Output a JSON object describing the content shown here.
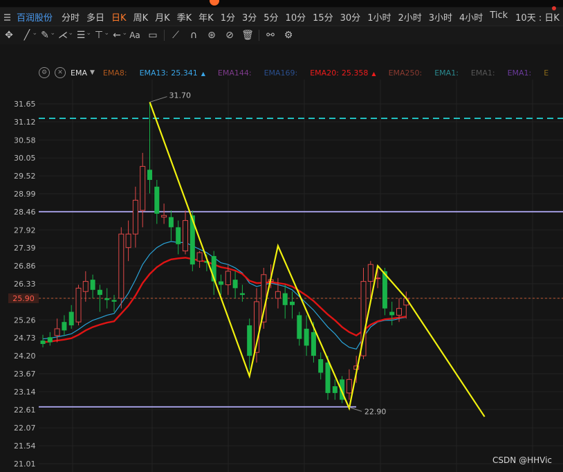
{
  "window": {
    "title": "百润股份"
  },
  "toolbar": {
    "stock_name": "百润股份",
    "timeframes": [
      "分时",
      "多日",
      "日K",
      "周K",
      "月K",
      "季K",
      "年K",
      "1分",
      "3分",
      "5分",
      "10分",
      "15分",
      "30分",
      "1小时",
      "2小时",
      "3小时",
      "4小时",
      "Tick"
    ],
    "active_timeframe": "日K",
    "period_label": "10天 : 日K"
  },
  "drawing_tools": [
    "move-icon",
    "line-icon",
    "pen-icon",
    "pattern-icon",
    "fib-icon",
    "measure-icon",
    "arrow-icon",
    "text-icon",
    "comment-icon",
    "ruler-icon",
    "magnet-icon",
    "eye-icon",
    "hide-icon",
    "trash-icon",
    "link-icon",
    "settings-icon"
  ],
  "indicator": {
    "name": "EMA",
    "items": [
      {
        "label": "EMA8:",
        "value": "",
        "color": "#b0581e"
      },
      {
        "label": "EMA13:",
        "value": "25.341",
        "color": "#3aa6e8",
        "arrow": "▲"
      },
      {
        "label": "EMA144:",
        "value": "",
        "color": "#7d3a8a"
      },
      {
        "label": "EMA169:",
        "value": "",
        "color": "#2a4e8c"
      },
      {
        "label": "EMA20:",
        "value": "25.358",
        "color": "#ee1c1c",
        "arrow": "▲"
      },
      {
        "label": "EMA250:",
        "value": "",
        "color": "#8a3a30"
      },
      {
        "label": "EMA1:",
        "value": "",
        "color": "#2a8a90"
      },
      {
        "label": "EMA1:",
        "value": "",
        "color": "#555555"
      },
      {
        "label": "EMA1:",
        "value": "",
        "color": "#6a3a9a"
      },
      {
        "label": "E",
        "value": "",
        "color": "#8a6a1a"
      }
    ]
  },
  "chart_data": {
    "type": "candlestick",
    "y_ticks": [
      "31.65",
      "31.12",
      "30.58",
      "30.05",
      "29.52",
      "28.99",
      "28.46",
      "27.92",
      "27.39",
      "26.86",
      "26.33",
      "25.90",
      "25.26",
      "24.73",
      "24.20",
      "23.67",
      "23.14",
      "22.61",
      "22.07",
      "21.54",
      "21.01"
    ],
    "ylim": [
      21.01,
      31.65
    ],
    "current_price": 25.9,
    "high_label": "31.70",
    "low_label": "22.90",
    "horizontal_lines": [
      {
        "price": 31.22,
        "style": "dashed",
        "color": "#21c0c0"
      },
      {
        "price": 28.46,
        "style": "solid",
        "color": "#a29ce0"
      },
      {
        "price": 22.69,
        "style": "solid",
        "color": "#a29ce0"
      }
    ],
    "candles": [
      [
        24.65,
        24.55,
        24.82,
        24.45
      ],
      [
        24.75,
        24.6,
        24.9,
        24.5
      ],
      [
        24.8,
        25.0,
        25.3,
        24.6
      ],
      [
        25.2,
        24.95,
        25.4,
        24.8
      ],
      [
        25.5,
        25.1,
        25.7,
        25.0
      ],
      [
        25.2,
        26.2,
        26.3,
        25.1
      ],
      [
        26.1,
        26.4,
        26.7,
        25.8
      ],
      [
        26.45,
        26.15,
        26.6,
        25.9
      ],
      [
        26.15,
        26.0,
        26.3,
        25.5
      ],
      [
        25.9,
        25.85,
        26.2,
        25.6
      ],
      [
        25.85,
        25.8,
        26.0,
        25.5
      ],
      [
        25.9,
        27.8,
        28.0,
        25.6
      ],
      [
        27.4,
        27.8,
        28.2,
        27.0
      ],
      [
        27.8,
        28.8,
        29.2,
        27.4
      ],
      [
        28.5,
        29.8,
        30.2,
        28.0
      ],
      [
        29.7,
        29.4,
        31.7,
        29.0
      ],
      [
        29.2,
        28.4,
        29.4,
        28.1
      ],
      [
        28.3,
        28.35,
        28.7,
        28.1
      ],
      [
        28.3,
        28.0,
        28.5,
        27.6
      ],
      [
        28.0,
        27.5,
        28.2,
        27.2
      ],
      [
        27.3,
        28.2,
        28.5,
        27.2
      ],
      [
        28.35,
        26.9,
        28.5,
        26.7
      ],
      [
        27.0,
        27.25,
        27.3,
        26.8
      ],
      [
        27.0,
        26.95,
        27.2,
        26.7
      ],
      [
        27.15,
        26.4,
        27.3,
        26.0
      ],
      [
        26.4,
        26.3,
        26.6,
        26.0
      ],
      [
        26.3,
        26.7,
        26.9,
        26.0
      ],
      [
        26.45,
        26.2,
        26.7,
        25.9
      ],
      [
        26.05,
        26.0,
        26.3,
        25.8
      ],
      [
        25.1,
        24.2,
        25.3,
        23.8
      ],
      [
        24.3,
        25.8,
        26.2,
        24.0
      ],
      [
        25.2,
        26.6,
        26.8,
        25.0
      ],
      [
        26.4,
        26.45,
        26.9,
        26.2
      ],
      [
        25.9,
        26.1,
        26.5,
        25.6
      ],
      [
        26.05,
        25.7,
        26.3,
        25.3
      ],
      [
        25.8,
        25.7,
        26.1,
        25.3
      ],
      [
        25.4,
        24.7,
        25.5,
        24.5
      ],
      [
        25.0,
        24.5,
        25.4,
        24.2
      ],
      [
        24.9,
        24.2,
        25.2,
        24.0
      ],
      [
        24.1,
        23.7,
        24.3,
        23.5
      ],
      [
        24.0,
        23.1,
        24.2,
        22.9
      ],
      [
        23.3,
        23.1,
        23.5,
        22.9
      ],
      [
        23.5,
        22.9,
        23.6,
        22.8
      ],
      [
        23.1,
        23.5,
        23.8,
        22.9
      ],
      [
        23.8,
        23.9,
        24.2,
        23.4
      ],
      [
        24.2,
        26.4,
        26.8,
        24.1
      ],
      [
        26.4,
        26.9,
        27.0,
        25.9
      ],
      [
        26.5,
        26.5,
        26.8,
        26.2
      ],
      [
        26.7,
        25.6,
        26.8,
        25.4
      ],
      [
        25.5,
        25.4,
        25.8,
        25.1
      ],
      [
        25.4,
        25.6,
        25.9,
        25.2
      ],
      [
        25.7,
        25.9,
        26.1,
        25.3
      ]
    ],
    "zigzag": [
      {
        "candle": 15,
        "price": 31.7
      },
      {
        "candle": 29,
        "price": 23.6
      },
      {
        "candle": 33,
        "price": 27.45
      },
      {
        "candle": 43,
        "price": 22.65
      },
      {
        "candle": 47,
        "price": 26.86
      },
      {
        "candle": 51,
        "price": 25.9
      },
      {
        "candle": 62,
        "price": 22.4
      }
    ],
    "ema13": [
      24.7,
      24.72,
      24.76,
      24.8,
      24.85,
      24.98,
      25.13,
      25.25,
      25.32,
      25.4,
      25.45,
      25.75,
      26.05,
      26.45,
      26.9,
      27.2,
      27.4,
      27.52,
      27.58,
      27.55,
      27.55,
      27.45,
      27.35,
      27.25,
      27.1,
      26.95,
      26.9,
      26.8,
      26.65,
      26.35,
      26.25,
      26.3,
      26.35,
      26.3,
      26.25,
      26.15,
      25.95,
      25.75,
      25.55,
      25.3,
      25.05,
      24.85,
      24.6,
      24.45,
      24.4,
      24.75,
      25.05,
      25.2,
      25.25,
      25.25,
      25.3,
      25.34
    ],
    "ema20": [
      24.6,
      24.62,
      24.65,
      24.68,
      24.72,
      24.82,
      24.95,
      25.05,
      25.12,
      25.18,
      25.22,
      25.45,
      25.68,
      25.98,
      26.35,
      26.62,
      26.82,
      26.96,
      27.05,
      27.08,
      27.1,
      27.06,
      27.02,
      26.98,
      26.9,
      26.82,
      26.78,
      26.72,
      26.62,
      26.42,
      26.35,
      26.36,
      26.38,
      26.35,
      26.32,
      26.25,
      26.12,
      25.98,
      25.82,
      25.62,
      25.42,
      25.25,
      25.05,
      24.9,
      24.8,
      24.95,
      25.12,
      25.22,
      25.28,
      25.3,
      25.33,
      25.36
    ]
  },
  "watermark": "CSDN @HHVic"
}
